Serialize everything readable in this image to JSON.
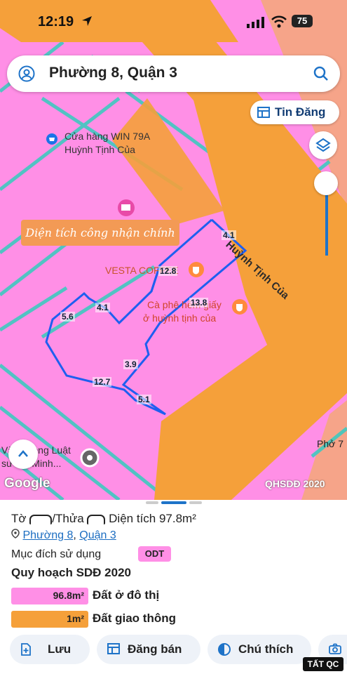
{
  "status_bar": {
    "time": "12:19",
    "battery": "75"
  },
  "search": {
    "title": "Phường 8, Quận 3"
  },
  "buttons": {
    "tin_dang": "Tin Đăng"
  },
  "map": {
    "pois": {
      "win79a_line1": "Cửa hàng WIN 79A",
      "win79a_line2": "Huỳnh Tịnh Của",
      "vesta": "VESTA COFFEE",
      "caphe_line1": "Cà phê hẻm giấy",
      "caphe_line2": "ở huỳnh tịnh của",
      "luat_line1": "Văn phòng Luật",
      "luat_line2": "sư Thị Minh...",
      "pho": "Phở 7"
    },
    "street": "Huỳnh Tịnh Của",
    "note": "Diện tích công nhận chính",
    "dimensions": [
      "4.1",
      "12.8",
      "13.8",
      "5.6",
      "4.1",
      "3.9",
      "12.7",
      "5.1"
    ],
    "google": "Google",
    "qhsdd": "QHSDĐ 2020"
  },
  "sheet": {
    "title_prefix": "Tờ",
    "title_mid": "/Thửa",
    "area_label": "Diện tích 97.8m²",
    "ward": "Phường 8",
    "district": "Quận 3",
    "purpose_label": "Mục đích sử dụng",
    "purpose_code": "ODT",
    "plan_title": "Quy hoạch SDĐ 2020",
    "legend": [
      {
        "value": "96.8m²",
        "label": "Đất ở đô thị",
        "color": "#ff8fe6"
      },
      {
        "value": "1m²",
        "label": "Đất giao thông",
        "color": "#f5a03a"
      }
    ],
    "actions": {
      "save": "Lưu",
      "post": "Đăng bán",
      "legend": "Chú thích"
    },
    "badge": "TẤT QC"
  }
}
